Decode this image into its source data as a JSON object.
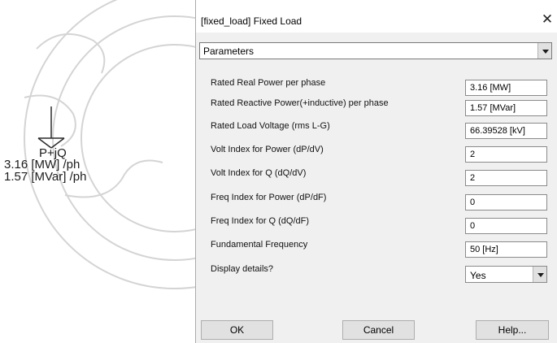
{
  "schematic": {
    "component_name": "P+jQ",
    "real_power_label": "3.16 [MW] /ph",
    "reactive_power_label": "1.57 [MVar] /ph"
  },
  "dialog": {
    "title": "[fixed_load] Fixed Load",
    "close_symbol": "✕",
    "section_selected": "Parameters",
    "parameters": [
      {
        "label": "Rated Real Power per phase",
        "value": "3.16 [MW]",
        "kind": "text"
      },
      {
        "label": "Rated Reactive Power(+inductive) per phase",
        "value": "1.57 [MVar]",
        "kind": "text"
      },
      {
        "label": "Rated Load Voltage (rms L-G)",
        "value": "66.39528 [kV]",
        "kind": "text"
      },
      {
        "label": "Volt Index for Power (dP/dV)",
        "value": "2",
        "kind": "text"
      },
      {
        "label": "Volt Index for Q (dQ/dV)",
        "value": "2",
        "kind": "text"
      },
      {
        "label": "Freq Index for Power (dP/dF)",
        "value": "0",
        "kind": "text"
      },
      {
        "label": "Freq Index for Q (dQ/dF)",
        "value": "0",
        "kind": "text"
      },
      {
        "label": "Fundamental Frequency",
        "value": "50 [Hz]",
        "kind": "text"
      },
      {
        "label": "Display details?",
        "value": "Yes",
        "kind": "select"
      }
    ],
    "buttons": {
      "ok": "OK",
      "cancel": "Cancel",
      "help": "Help..."
    }
  },
  "colors": {
    "dialog_background": "#f0f0f0",
    "titlebar": "#ffffff",
    "button_face": "#e1e1e1",
    "watermark": "#c9c9c9"
  }
}
